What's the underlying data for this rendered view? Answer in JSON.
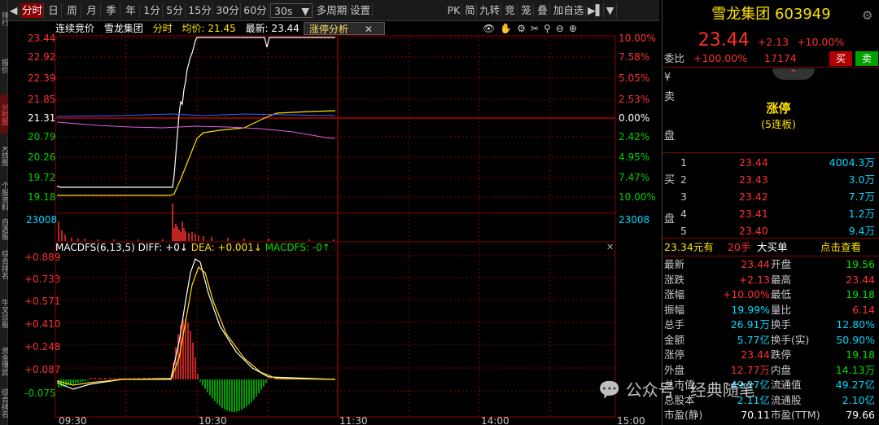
{
  "left_tabs": [
    "排行",
    "报价",
    "分时图",
    "K线图",
    "个股资料",
    "自选股",
    "综合排名",
    "牛叉诊股",
    "资金博弈",
    "综合排名"
  ],
  "toolbar": {
    "items": [
      "分时",
      "日",
      "周",
      "月",
      "季",
      "年",
      "1分",
      "5分",
      "15分",
      "30分",
      "60分"
    ],
    "period_select": "30s",
    "multi_period": "多周期",
    "settings": "设置",
    "right_items": [
      "PK",
      "简",
      "九转",
      "竞",
      "笼",
      "叠",
      "加自选"
    ]
  },
  "info": {
    "auction": "连续竞价",
    "stock_name": "雪龙集团",
    "mode": "分时",
    "avg_price": "均价: 21.45",
    "latest": "最新: 23.44",
    "limit_up": "涨停",
    "analysis_button": "涨停分析"
  },
  "price_axis_left": [
    "23.44",
    "22.92",
    "22.39",
    "21.85",
    "21.31",
    "20.79",
    "20.26",
    "19.72",
    "19.18"
  ],
  "pct_axis_right": [
    "10.00%",
    "7.58%",
    "5.05%",
    "2.53%",
    "0.00%",
    "2.42%",
    "4.95%",
    "7.47%",
    "10.00%"
  ],
  "volume_axis": "23008",
  "macd_axis": [
    "+0.889",
    "+0.733",
    "+0.571",
    "+0.410",
    "+0.248",
    "+0.087",
    "-0.075"
  ],
  "macd_info": {
    "label": "MACDFS(6,13,5)",
    "diff": "DIFF: +0↓",
    "dea": "DEA: +0.001↓",
    "macdfs": "MACDFS: -0↑"
  },
  "time_axis": [
    "09:30",
    "10:30",
    "11:30",
    "14:00",
    "15:00"
  ],
  "right": {
    "name": "雪龙集团",
    "code": "603949",
    "price": "23.44",
    "change": "+2.13",
    "change_pct": "+10.00%",
    "weibi_label": "委比",
    "weibi": "+100.00%",
    "weicha": "17174",
    "buy_btn": "买",
    "sell_btn": "卖",
    "sell_label": [
      "¥",
      "卖",
      "",
      "盘"
    ],
    "limit_text": "涨停",
    "limit_sub": "(5连板)",
    "buy_label": [
      "买",
      "",
      "盘"
    ],
    "bids": [
      {
        "lv": "1",
        "price": "23.44",
        "vol": "4004.3万"
      },
      {
        "lv": "2",
        "price": "23.43",
        "vol": "3.0万"
      },
      {
        "lv": "3",
        "price": "23.42",
        "vol": "7.7万"
      },
      {
        "lv": "4",
        "price": "23.41",
        "vol": "1.2万"
      },
      {
        "lv": "5",
        "price": "23.40",
        "vol": "9.4万"
      }
    ],
    "big_order": {
      "price": "23.34元有",
      "qty": "20手",
      "text": "大买单",
      "link": "点击查看"
    },
    "stats": [
      [
        "最新",
        "23.44",
        "开盘",
        "19.56"
      ],
      [
        "涨跌",
        "+2.13",
        "最高",
        "23.44"
      ],
      [
        "涨幅",
        "+10.00%",
        "最低",
        "19.18"
      ],
      [
        "振幅",
        "19.99%",
        "量比",
        "6.14"
      ],
      [
        "总手",
        "26.91万",
        "换手",
        "12.80%"
      ],
      [
        "金额",
        "5.77亿",
        "换手(实)",
        "50.90%"
      ],
      [
        "涨停",
        "23.44",
        "跌停",
        "19.18"
      ],
      [
        "外盘",
        "12.77万",
        "内盘",
        "14.13万"
      ],
      [
        "总市值",
        "49.27亿",
        "流通值",
        "49.27亿"
      ],
      [
        "总股本",
        "2.11亿",
        "流通股",
        "2.10亿"
      ],
      [
        "市盈(静)",
        "70.11",
        "市盈(TTM)",
        "79.66"
      ]
    ]
  },
  "watermark": "公众号 · 经典随笔"
}
